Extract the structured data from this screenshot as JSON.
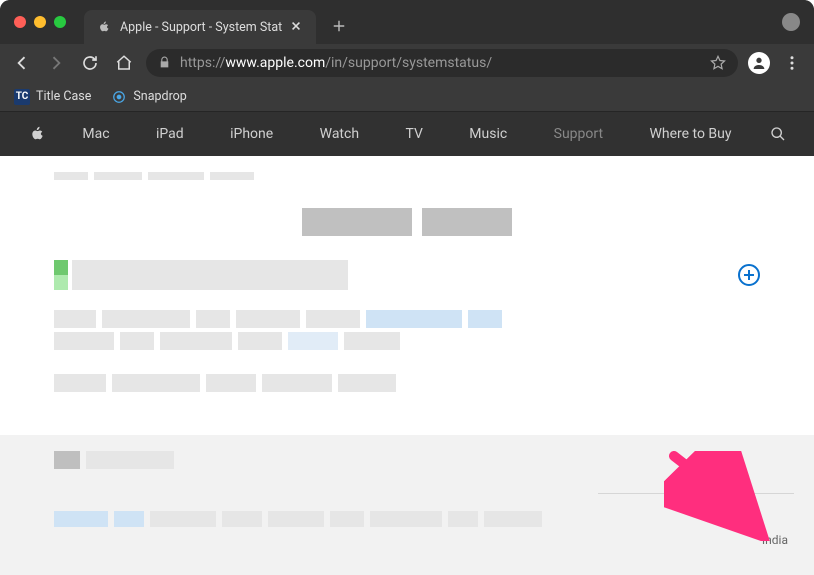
{
  "browser": {
    "tab_title": "Apple - Support - System Stat",
    "url_protocol": "https://",
    "url_prefix": "www.",
    "url_domain": "apple.com",
    "url_path": "/in/support/systemstatus/",
    "bookmarks": [
      {
        "label": "Title Case",
        "icon": "TC"
      },
      {
        "label": "Snapdrop",
        "icon": "◎"
      }
    ]
  },
  "nav": {
    "items": [
      "Mac",
      "iPad",
      "iPhone",
      "Watch",
      "TV",
      "Music",
      "Support",
      "Where to Buy"
    ],
    "active": "Support"
  },
  "footer": {
    "country": "India"
  },
  "annotation": {
    "arrow_color": "#ff2e7e"
  }
}
